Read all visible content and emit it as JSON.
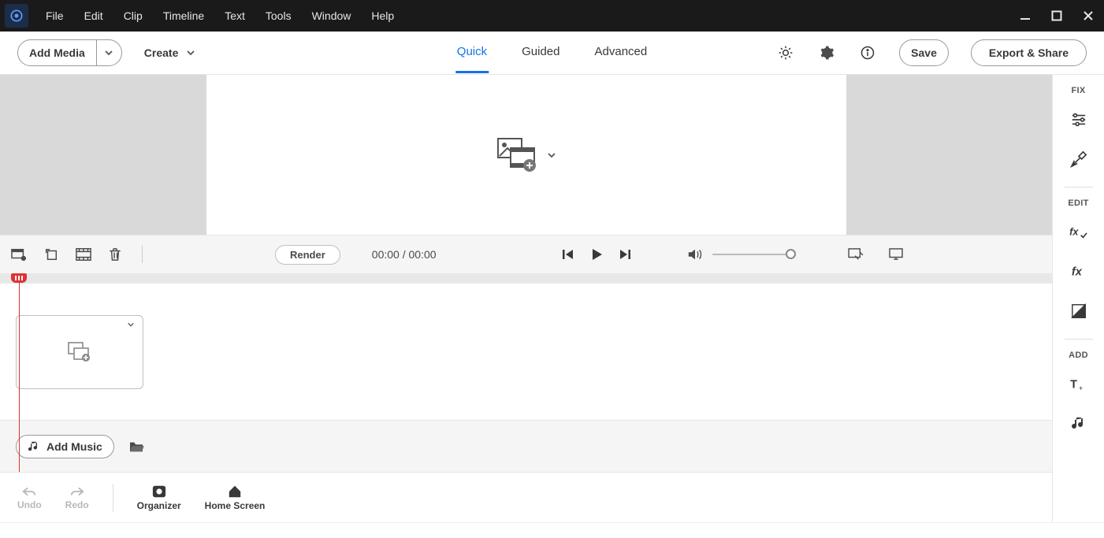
{
  "menu": {
    "items": [
      "File",
      "Edit",
      "Clip",
      "Timeline",
      "Text",
      "Tools",
      "Window",
      "Help"
    ]
  },
  "toolbar": {
    "add_media": "Add Media",
    "create": "Create",
    "tabs": {
      "quick": "Quick",
      "guided": "Guided",
      "advanced": "Advanced",
      "active": "quick"
    },
    "save": "Save",
    "export": "Export & Share"
  },
  "right_panel": {
    "fix": "FIX",
    "edit": "EDIT",
    "add": "ADD"
  },
  "playback": {
    "render": "Render",
    "time_current": "00:00",
    "time_sep": " / ",
    "time_total": "00:00"
  },
  "audio": {
    "add_music": "Add Music"
  },
  "bottom": {
    "undo": "Undo",
    "redo": "Redo",
    "organizer": "Organizer",
    "home": "Home Screen"
  }
}
